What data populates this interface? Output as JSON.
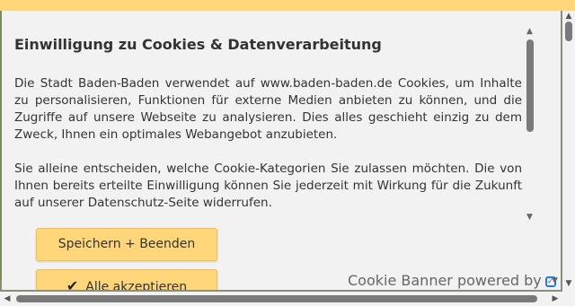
{
  "banner": {
    "title": "Einwilligung zu Cookies & Datenverarbeitung",
    "paragraph1": "Die Stadt Baden-Baden verwendet auf www.baden-baden.de Cookies, um Inhalte zu personalisieren, Funktionen für externe Medien anbieten zu können, und die Zugriffe auf unsere Webseite zu analysieren. Dies alles geschieht einzig zu dem Zweck, Ihnen ein optimales Webangebot anzubieten.",
    "paragraph2": "Sie alleine entscheiden, welche Cookie-Kategorien Sie zulassen möchten. Die von Ihnen bereits erteilte Einwilligung können Sie jederzeit mit Wirkung für die Zukunft auf unserer Datenschutz-Seite widerrufen.",
    "buttons": {
      "save_label": "Speichern + Beenden",
      "accept_label": "Alle akzeptieren"
    },
    "powered_by": "Cookie Banner powered by"
  },
  "icons": {
    "check": "check-icon",
    "shield": "shield-check-icon",
    "caret": "chevron-down-icon"
  },
  "colors": {
    "accent": "#ffd77a",
    "panel_bg": "#f2f2f2",
    "text": "#333333",
    "brand_icon": "#2a7be4"
  }
}
